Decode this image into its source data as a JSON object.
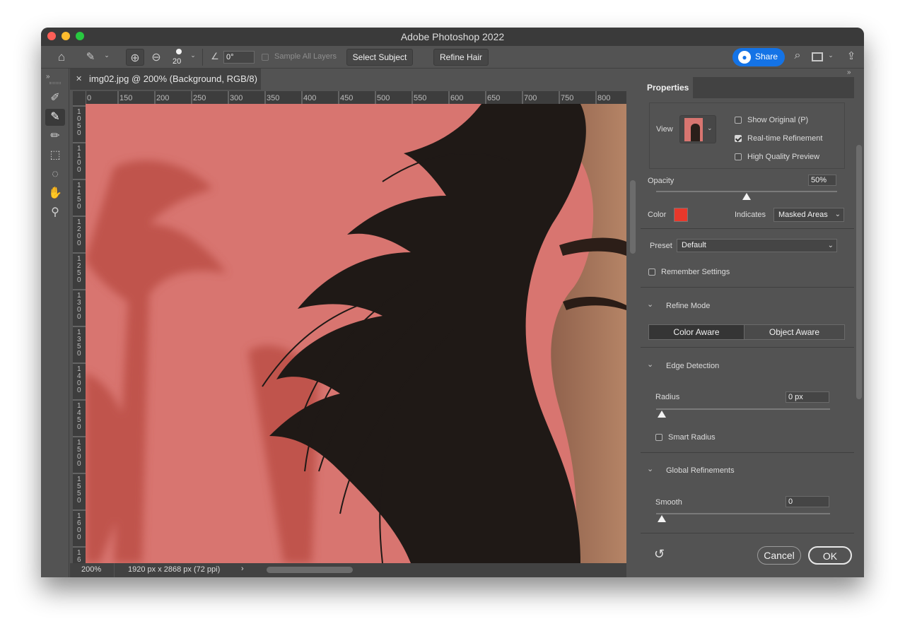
{
  "app_title": "Adobe Photoshop 2022",
  "options": {
    "brush_size": "20",
    "angle_value": "0°",
    "sample_all_layers": "Sample All Layers",
    "select_subject": "Select Subject",
    "refine_hair": "Refine Hair",
    "share": "Share"
  },
  "document": {
    "tab_title": "img02.jpg @ 200% (Background, RGB/8)",
    "zoom": "200%",
    "dimensions": "1920 px x 2868 px (72 ppi)"
  },
  "ruler": {
    "h_ticks": [
      "0",
      "150",
      "200",
      "250",
      "300",
      "350",
      "400",
      "450",
      "500",
      "550",
      "600",
      "650",
      "700",
      "750",
      "800"
    ],
    "v_ticks": [
      "1 0 5 0",
      "1 1 0 0",
      "1 1 5 0",
      "1 2 0 0",
      "1 2 5 0",
      "1 3 0 0",
      "1 3 5 0",
      "1 4 0 0",
      "1 4 5 0",
      "1 5 0 0",
      "1 5 5 0",
      "1 6 0 0",
      "1 6"
    ]
  },
  "properties": {
    "tab": "Properties",
    "view_label": "View",
    "show_original": "Show Original (P)",
    "realtime_refinement": "Real-time Refinement",
    "high_quality_preview": "High Quality Preview",
    "opacity_label": "Opacity",
    "opacity_value": "50%",
    "opacity_fraction": 0.5,
    "color_label": "Color",
    "overlay_color": "#e8382b",
    "indicates_label": "Indicates",
    "indicates_value": "Masked Areas",
    "preset_label": "Preset",
    "preset_value": "Default",
    "remember_settings": "Remember Settings",
    "refine_mode": "Refine Mode",
    "color_aware": "Color Aware",
    "object_aware": "Object Aware",
    "edge_detection": "Edge Detection",
    "radius_label": "Radius",
    "radius_value": "0 px",
    "smart_radius": "Smart Radius",
    "global_refinements": "Global Refinements",
    "smooth_label": "Smooth",
    "smooth_value": "0",
    "cancel": "Cancel",
    "ok": "OK"
  }
}
